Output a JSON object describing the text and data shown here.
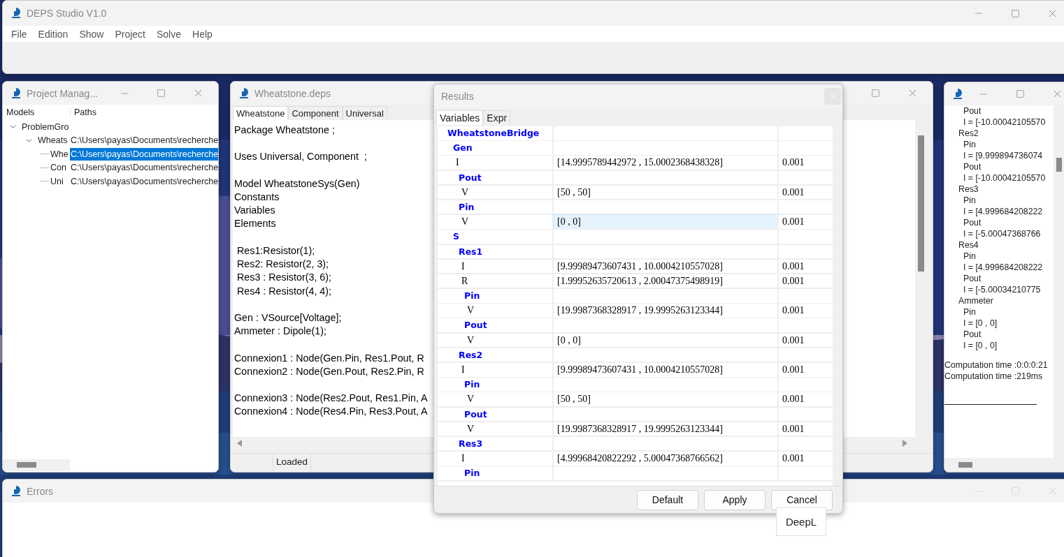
{
  "main_window": {
    "title": "DEPS Studio V1.0",
    "menu": [
      "File",
      "Edition",
      "Show",
      "Project",
      "Solve",
      "Help"
    ]
  },
  "project_manager": {
    "title": "Project Manag...",
    "columns": [
      "Models",
      "Paths"
    ],
    "tree": [
      {
        "label": "ProblemGro",
        "expanded": true,
        "selected": false,
        "children": [
          {
            "label": "Wheats",
            "expanded": true,
            "selected": false,
            "path": "C:\\Users\\payas\\Documents\\recherche",
            "children": [
              {
                "label": "Whe",
                "selected": true,
                "path": "C:\\Users\\payas\\Documents\\recherche"
              },
              {
                "label": "Con",
                "selected": false,
                "path": "C:\\Users\\payas\\Documents\\recherche"
              },
              {
                "label": "Uni",
                "selected": false,
                "path": "C:\\Users\\payas\\Documents\\recherche"
              }
            ]
          }
        ]
      }
    ]
  },
  "editor": {
    "title": "Wheatstone.deps",
    "tabs": [
      {
        "label": "Wheatstone",
        "selected": true
      },
      {
        "label": "Component",
        "selected": false
      },
      {
        "label": "Universal",
        "selected": false
      }
    ],
    "blocks": [
      [
        "Package Wheatstone ;"
      ],
      [
        "Uses Universal, Component  ;"
      ],
      [
        "Model WheatstoneSys(Gen)",
        "Constants",
        "Variables",
        "Elements"
      ],
      [
        " Res1:Resistor(1);",
        " Res2: Resistor(2, 3);",
        " Res3 : Resistor(3, 6);",
        " Res4 : Resistor(4, 4);"
      ],
      [
        "Gen : VSource[Voltage];",
        "Ammeter : Dipole(1);"
      ],
      [
        "Connexion1 : Node(Gen.Pin, Res1.Pout, R",
        "Connexion2 : Node(Gen.Pout, Res2.Pin, R"
      ],
      [
        "Connexion3 : Node(Res2.Pout, Res1.Pin, A",
        "Connexion4 : Node(Res4.Pin, Res3.Pout, A"
      ]
    ],
    "status": "Loaded"
  },
  "results": {
    "title": "Results",
    "tabs": [
      {
        "label": "Variables",
        "selected": true
      },
      {
        "label": "Expr",
        "selected": false
      }
    ],
    "rows": [
      {
        "kind": "group",
        "name": "WheatstoneBridge",
        "children": [
          {
            "kind": "group",
            "name": "Gen",
            "children": [
              {
                "kind": "variable",
                "name": "I",
                "value": "[14.9995789442972 , 15.0002368438328]",
                "precision": "0.001",
                "selected": false
              },
              {
                "kind": "group",
                "name": "Pout",
                "children": [
                  {
                    "kind": "variable",
                    "name": "V",
                    "value": "[50 , 50]",
                    "precision": "0.001",
                    "selected": false
                  }
                ]
              },
              {
                "kind": "group",
                "name": "Pin",
                "children": [
                  {
                    "kind": "variable",
                    "name": "V",
                    "value": "[0 , 0]",
                    "precision": "0.001",
                    "selected": true
                  }
                ]
              }
            ]
          },
          {
            "kind": "group",
            "name": "S",
            "children": [
              {
                "kind": "group",
                "name": "Res1",
                "children": [
                  {
                    "kind": "variable",
                    "name": "I",
                    "value": "[9.99989473607431 , 10.0004210557028]",
                    "precision": "0.001",
                    "selected": false
                  },
                  {
                    "kind": "variable",
                    "name": "R",
                    "value": "[1.99952635720613 , 2.00047375498919]",
                    "precision": "0.001",
                    "selected": false
                  },
                  {
                    "kind": "group",
                    "name": "Pin",
                    "children": [
                      {
                        "kind": "variable",
                        "name": "V",
                        "value": "[19.9987368328917 , 19.9995263123344]",
                        "precision": "0.001",
                        "selected": false
                      }
                    ]
                  },
                  {
                    "kind": "group",
                    "name": "Pout",
                    "children": [
                      {
                        "kind": "variable",
                        "name": "V",
                        "value": "[0 , 0]",
                        "precision": "0.001",
                        "selected": false
                      }
                    ]
                  }
                ]
              },
              {
                "kind": "group",
                "name": "Res2",
                "children": [
                  {
                    "kind": "variable",
                    "name": "I",
                    "value": "[9.99989473607431 , 10.0004210557028]",
                    "precision": "0.001",
                    "selected": false
                  },
                  {
                    "kind": "group",
                    "name": "Pin",
                    "children": [
                      {
                        "kind": "variable",
                        "name": "V",
                        "value": "[50 , 50]",
                        "precision": "0.001",
                        "selected": false
                      }
                    ]
                  },
                  {
                    "kind": "group",
                    "name": "Pout",
                    "children": [
                      {
                        "kind": "variable",
                        "name": "V",
                        "value": "[19.9987368328917 , 19.9995263123344]",
                        "precision": "0.001",
                        "selected": false
                      }
                    ]
                  }
                ]
              },
              {
                "kind": "group",
                "name": "Res3",
                "children": [
                  {
                    "kind": "variable",
                    "name": "I",
                    "value": "[4.99968420822292 , 5.00047368766562]",
                    "precision": "0.001",
                    "selected": false
                  },
                  {
                    "kind": "group",
                    "name": "Pin"
                  }
                ]
              }
            ]
          }
        ]
      }
    ],
    "buttons": [
      "Default",
      "Apply",
      "Cancel"
    ]
  },
  "output": {
    "partial_top": [
      {
        "label": "Pout",
        "children": [
          {
            "label": "I = [-10.00042105570"
          }
        ]
      }
    ],
    "tree": [
      {
        "label": "Res2",
        "children": [
          {
            "label": "Pin",
            "children": [
              {
                "label": "I = [9.999894736074"
              }
            ]
          },
          {
            "label": "Pout",
            "children": [
              {
                "label": "I = [-10.00042105570"
              }
            ]
          }
        ]
      },
      {
        "label": "Res3",
        "children": [
          {
            "label": "Pin",
            "children": [
              {
                "label": "I = [4.999684208222"
              }
            ]
          },
          {
            "label": "Pout",
            "children": [
              {
                "label": "I = [-5.00047368766"
              }
            ]
          }
        ]
      },
      {
        "label": "Res4",
        "children": [
          {
            "label": "Pin",
            "children": [
              {
                "label": "I = [4.999684208222"
              }
            ]
          },
          {
            "label": "Pout",
            "children": [
              {
                "label": "I = [-5.00034210775"
              }
            ]
          }
        ]
      },
      {
        "label": "Ammeter",
        "children": [
          {
            "label": "Pin",
            "children": [
              {
                "label": "I = [0 , 0]"
              }
            ]
          },
          {
            "label": "Pout",
            "children": [
              {
                "label": "I = [0 , 0]"
              }
            ]
          }
        ]
      }
    ],
    "timings": [
      "Computation time :0:0:0:21",
      "Computation time :219ms"
    ]
  },
  "errors": {
    "title": "Errors"
  },
  "tooltip": {
    "text": "DeepL"
  }
}
